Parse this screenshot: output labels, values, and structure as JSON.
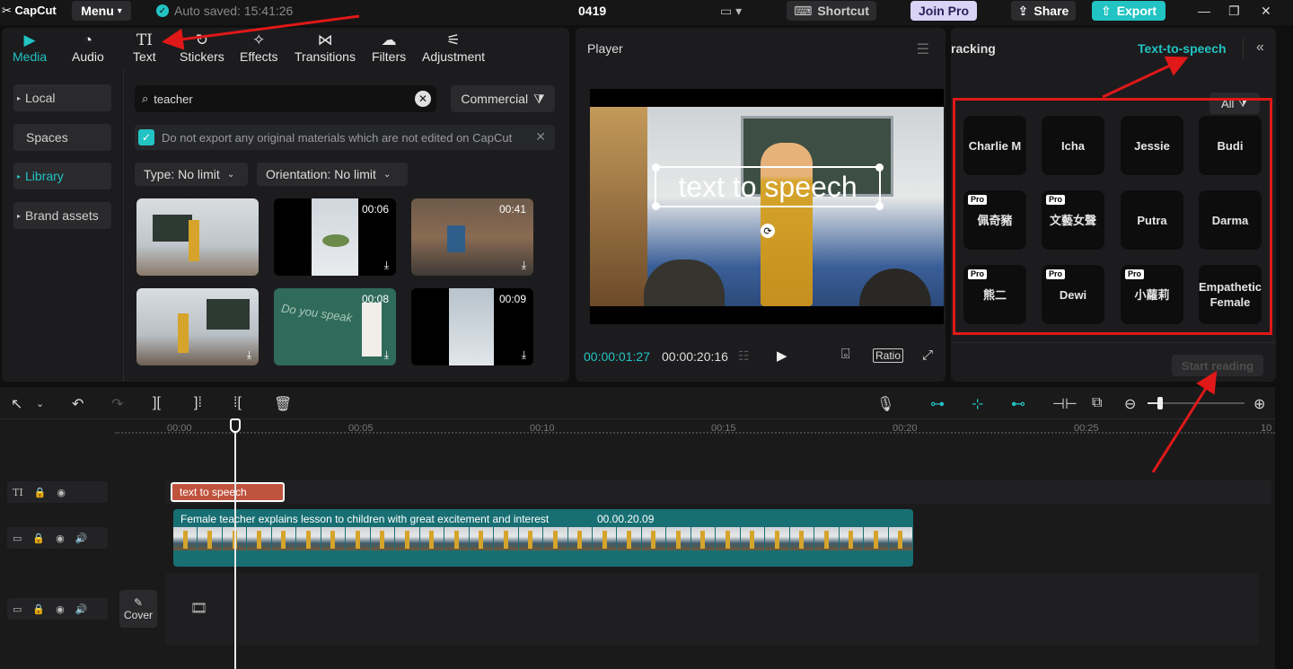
{
  "app": {
    "logo": "CapCut",
    "menu_label": "Menu",
    "autosave": "Auto saved: 15:41:26",
    "project_name": "0419"
  },
  "topbar": {
    "shortcut_label": "Shortcut",
    "joinpro_label": "Join Pro",
    "share_label": "Share",
    "export_label": "Export"
  },
  "tabs": [
    {
      "label": "Media",
      "icon": "media-icon"
    },
    {
      "label": "Audio",
      "icon": "audio-icon"
    },
    {
      "label": "Text",
      "icon": "text-icon"
    },
    {
      "label": "Stickers",
      "icon": "stickers-icon"
    },
    {
      "label": "Effects",
      "icon": "effects-icon"
    },
    {
      "label": "Transitions",
      "icon": "transitions-icon"
    },
    {
      "label": "Filters",
      "icon": "filters-icon"
    },
    {
      "label": "Adjustment",
      "icon": "adjustment-icon"
    }
  ],
  "sidebar": {
    "items": [
      {
        "label": "Local"
      },
      {
        "label": "Spaces"
      },
      {
        "label": "Library"
      },
      {
        "label": "Brand assets"
      }
    ]
  },
  "search": {
    "value": "teacher"
  },
  "commercial_label": "Commercial",
  "notice": "Do not export any original materials which are not edited on CapCut",
  "filters": {
    "type": "Type: No limit",
    "orientation": "Orientation: No limit"
  },
  "thumbs": [
    {
      "duration": ""
    },
    {
      "duration": "00:06"
    },
    {
      "duration": "00:41"
    },
    {
      "duration": ""
    },
    {
      "duration": "00:08"
    },
    {
      "duration": "00:09"
    }
  ],
  "player": {
    "title": "Player",
    "overlay_text": "text to speech",
    "time_current": "00:00:01:27",
    "time_total": "00:00:20:16",
    "ratio_label": "Ratio"
  },
  "right_panel": {
    "tab_tracking": "racking",
    "tab_tts": "Text-to-speech",
    "all_label": "All",
    "voices": [
      {
        "name": "Charlie M",
        "pro": ""
      },
      {
        "name": "Icha",
        "pro": ""
      },
      {
        "name": "Jessie",
        "pro": ""
      },
      {
        "name": "Budi",
        "pro": ""
      },
      {
        "name": "佩奇豬",
        "pro": "Pro"
      },
      {
        "name": "文藝女聲",
        "pro": "Pro"
      },
      {
        "name": "Putra",
        "pro": ""
      },
      {
        "name": "Darma",
        "pro": ""
      },
      {
        "name": "熊二",
        "pro": "Pro"
      },
      {
        "name": "Dewi",
        "pro": "Pro"
      },
      {
        "name": "小蘿莉",
        "pro": "Pro"
      },
      {
        "name": "Empathetic Female",
        "pro": ""
      }
    ],
    "start_reading": "Start reading"
  },
  "timeline": {
    "ruler": [
      "00:00",
      "00:05",
      "00:10",
      "00:15",
      "00:20",
      "00:25",
      "10"
    ],
    "text_clip": "text to speech",
    "video_clip_title": "Female teacher explains lesson to children with great excitement and interest",
    "video_clip_duration": "00.00.20.09",
    "cover_label": "Cover"
  },
  "colors": {
    "accent": "#22c3c3",
    "annotation": "#e01818",
    "text_clip": "#c0533e",
    "video_clip": "#186f73"
  }
}
